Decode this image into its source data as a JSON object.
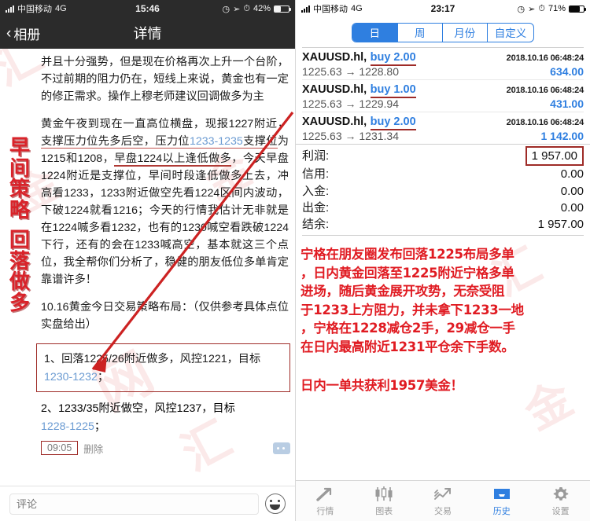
{
  "left": {
    "statusbar": {
      "carrier": "中国移动",
      "network": "4G",
      "time": "15:46",
      "battery": "42%"
    },
    "nav": {
      "back_label": "相册",
      "title": "详情"
    },
    "vertical_headline": [
      "早",
      "间",
      "策",
      "略",
      "回",
      "落",
      "做",
      "多"
    ],
    "paragraphs": [
      "并且十分强势，但是现在价格再次上升一个台阶，不过前期的阻力仍在，短线上来说，黄金也有一定的修正需求。操作上穆老师建议回调做多为主",
      "黄金午夜到现在一直高位横盘，现报1227附近，支撑压力位先多后空，压力位1233-1235支撑位为1215和1208，早盘1224以上逢低做多，今天早盘1224附近是支撑位，早间时段逢低做多上去，冲高看1233，1233附近做空先看1224区间内波动，下破1224就看1216；今天的行情我估计无非就是在1224喊多看1232，也有的1230喊空看跌破1224下行，还有的会在1233喊高空，基本就这三个点位，我全帮你们分析了，稳健的朋友低位多单肯定靠谱许多！",
      "10.16黄金今日交易策略布局：（仅供参考具体点位实盘给出）"
    ],
    "strategy_1": "1、回落1225/26附近做多，风控1221，目标1230-1232；",
    "strategy_2": "2、1233/35附近做空，风控1237，目标1228-1225；",
    "meta": {
      "time": "09:05",
      "delete": "删除"
    },
    "comment": {
      "placeholder": "评论"
    }
  },
  "right": {
    "statusbar": {
      "carrier": "中国移动",
      "network": "4G",
      "time": "23:17",
      "battery": "71%"
    },
    "segments": [
      {
        "label": "日",
        "active": true
      },
      {
        "label": "周",
        "active": false
      },
      {
        "label": "月份",
        "active": false
      },
      {
        "label": "自定义",
        "active": false
      }
    ],
    "deals": [
      {
        "symbol": "XAUUSD.hl,",
        "side": "buy 2.00",
        "datetime": "2018.10.16 06:48:24",
        "prices": "1225.63 → 1228.80",
        "profit": "634.00"
      },
      {
        "symbol": "XAUUSD.hl,",
        "side": "buy 1.00",
        "datetime": "2018.10.16 06:48:24",
        "prices": "1225.63 → 1229.94",
        "profit": "431.00"
      },
      {
        "symbol": "XAUUSD.hl,",
        "side": "buy 2.00",
        "datetime": "2018.10.16 06:48:24",
        "prices": "1225.63 → 1231.34",
        "profit": "1 142.00"
      }
    ],
    "summary": [
      {
        "label": "利润:",
        "value": "1 957.00",
        "highlight": true
      },
      {
        "label": "信用:",
        "value": "0.00",
        "highlight": false
      },
      {
        "label": "入金:",
        "value": "0.00",
        "highlight": false
      },
      {
        "label": "出金:",
        "value": "0.00",
        "highlight": false
      },
      {
        "label": "结余:",
        "value": "1 957.00",
        "highlight": false
      }
    ],
    "commentary": [
      "宁格在朋友圈发布回落1225布局多单",
      "，日内黄金回落至1225附近宁格多单",
      "进场，随后黄金展开攻势，无奈受阻",
      "于1233上方阻力，并未拿下1233一地",
      "，宁格在1228减仓2手，29减仓一手",
      "在日内最高附近1231平仓余下手数。"
    ],
    "commentary_footer": "日内一单共获利1957美金！",
    "tabs": [
      {
        "label": "行情",
        "icon": "quotes-icon",
        "active": false
      },
      {
        "label": "图表",
        "icon": "chart-icon",
        "active": false
      },
      {
        "label": "交易",
        "icon": "trade-icon",
        "active": false
      },
      {
        "label": "历史",
        "icon": "history-icon",
        "active": true
      },
      {
        "label": "设置",
        "icon": "settings-icon",
        "active": false
      }
    ]
  },
  "colors": {
    "accent_blue": "#2f7fe0",
    "annotation_red": "#9e2b27",
    "headline_red": "#d9232a"
  }
}
